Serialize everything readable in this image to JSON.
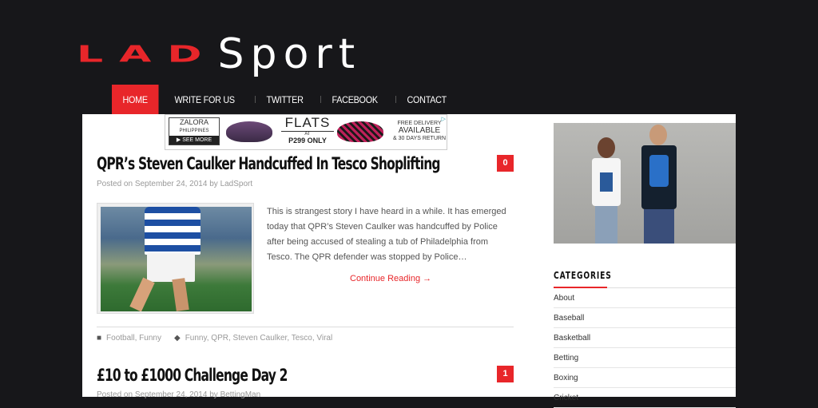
{
  "logo": {
    "part1": "LAD",
    "part2": "Sport"
  },
  "nav": {
    "items": [
      "HOME",
      "WRITE FOR US",
      "TWITTER",
      "FACEBOOK",
      "CONTACT"
    ]
  },
  "ad": {
    "brand": "ZALORA",
    "brand_sub": "PHILIPPINES",
    "brand_cta": "▶ SEE MORE",
    "headline": "FLATS",
    "at": "AT",
    "price": "P299 ONLY",
    "delivery1": "FREE DELIVERY",
    "delivery2": "AVAILABLE",
    "delivery3": "& 30 DAYS RETURN"
  },
  "posts": [
    {
      "title": "QPR’s Steven Caulker Handcuffed In Tesco Shoplifting",
      "meta_prefix": "Posted on ",
      "date": "September 24, 2014",
      "meta_by": " by ",
      "author": "LadSport",
      "comments": "0",
      "excerpt": "This is strangest story I have heard in a while. It has emerged today that QPR’s Steven Caulker was handcuffed by Police after being accused of stealing a tub of Philadelphia from Tesco. The QPR defender was stopped by Police…",
      "read_more": "Continue Reading →",
      "categories": "Football, Funny",
      "tags": "Funny, QPR, Steven Caulker, Tesco, Viral"
    },
    {
      "title": "£10 to £1000 Challenge Day 2",
      "meta_prefix": "Posted on ",
      "date": "September 24, 2014",
      "meta_by": " by ",
      "author": "BettingMan",
      "comments": "1"
    }
  ],
  "sidebar": {
    "categories_title": "CATEGORIES",
    "categories": [
      "About",
      "Baseball",
      "Basketball",
      "Betting",
      "Boxing",
      "Cricket"
    ]
  },
  "colors": {
    "accent": "#e8262a",
    "header_bg": "#17171a"
  },
  "icons": {
    "category": "folder-icon",
    "tags": "tag-icon"
  }
}
